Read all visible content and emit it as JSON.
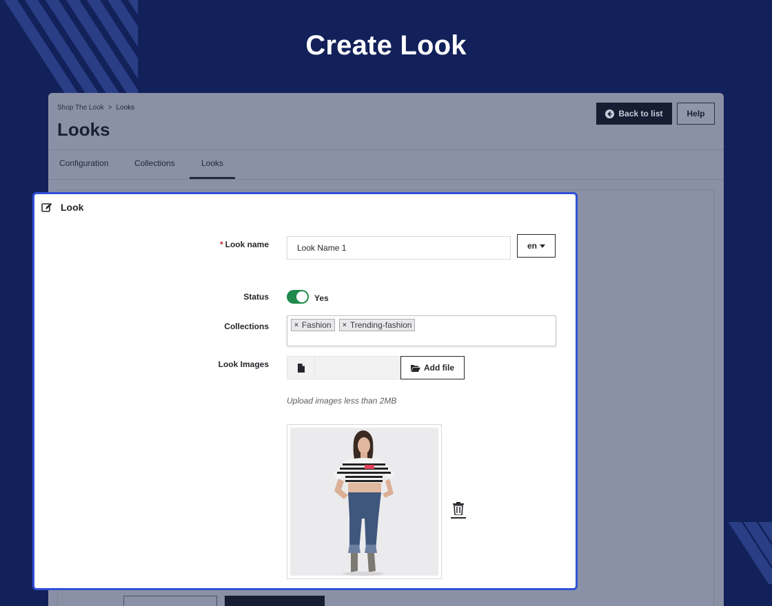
{
  "hero": {
    "title": "Create Look"
  },
  "header": {
    "breadcrumb": [
      "Shop The Look",
      "Looks"
    ],
    "breadcrumb_separator": ">",
    "page_title": "Looks",
    "back_label": "Back to list",
    "help_label": "Help"
  },
  "tabs": [
    {
      "label": "Configuration"
    },
    {
      "label": "Collections"
    },
    {
      "label": "Looks",
      "active": true
    }
  ],
  "form": {
    "card_title": "Look",
    "name_label": "Look name",
    "name_required_mark": "*",
    "name_value": "Look Name 1",
    "language": "en",
    "status_label": "Status",
    "status_value": "Yes",
    "status_on": true,
    "collections_label": "Collections",
    "collections": [
      "Fashion",
      "Trending-fashion"
    ],
    "tag_remove_glyph": "×",
    "images_label": "Look Images",
    "add_file_label": "Add file",
    "images_help": "Upload images less than 2MB"
  },
  "colors": {
    "background": "#13215a",
    "accent_focus": "#2f4fd8",
    "toggle_on": "#1f8a4c",
    "dark_button": "#161d33"
  },
  "icons": [
    "edit-icon",
    "arrow-left-circle-icon",
    "caret-down-icon",
    "file-icon",
    "folder-open-icon",
    "trash-icon"
  ]
}
